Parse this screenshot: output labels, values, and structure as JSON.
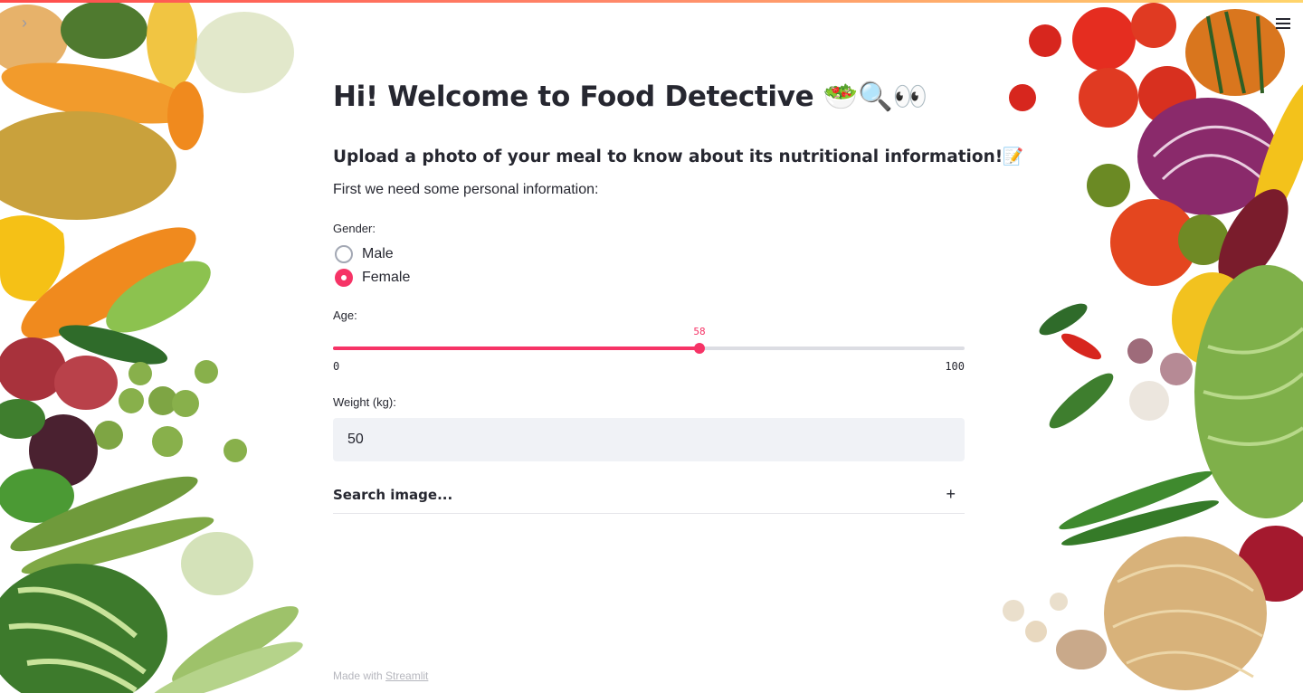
{
  "app": {
    "title": "Hi! Welcome to Food Detective 🥗🔍👀",
    "subtitle": "Upload a photo of your meal to know about its nutritional information!📝",
    "intro": "First we need some personal information:"
  },
  "icons": {
    "sidebar_toggle": "chevron-right-icon",
    "menu": "hamburger-menu-icon"
  },
  "gender": {
    "label": "Gender:",
    "options": [
      "Male",
      "Female"
    ],
    "selected": "Female"
  },
  "age": {
    "label": "Age:",
    "value": "58",
    "min": "0",
    "max": "100",
    "fraction": 0.58
  },
  "weight": {
    "label": "Weight (kg):",
    "value": "50"
  },
  "expander": {
    "label": "Search image...",
    "icon": "+"
  },
  "footer": {
    "prefix": "Made with ",
    "link": "Streamlit"
  },
  "colors": {
    "accent": "#f63366",
    "input_bg": "#f0f2f6",
    "text": "#262730"
  }
}
